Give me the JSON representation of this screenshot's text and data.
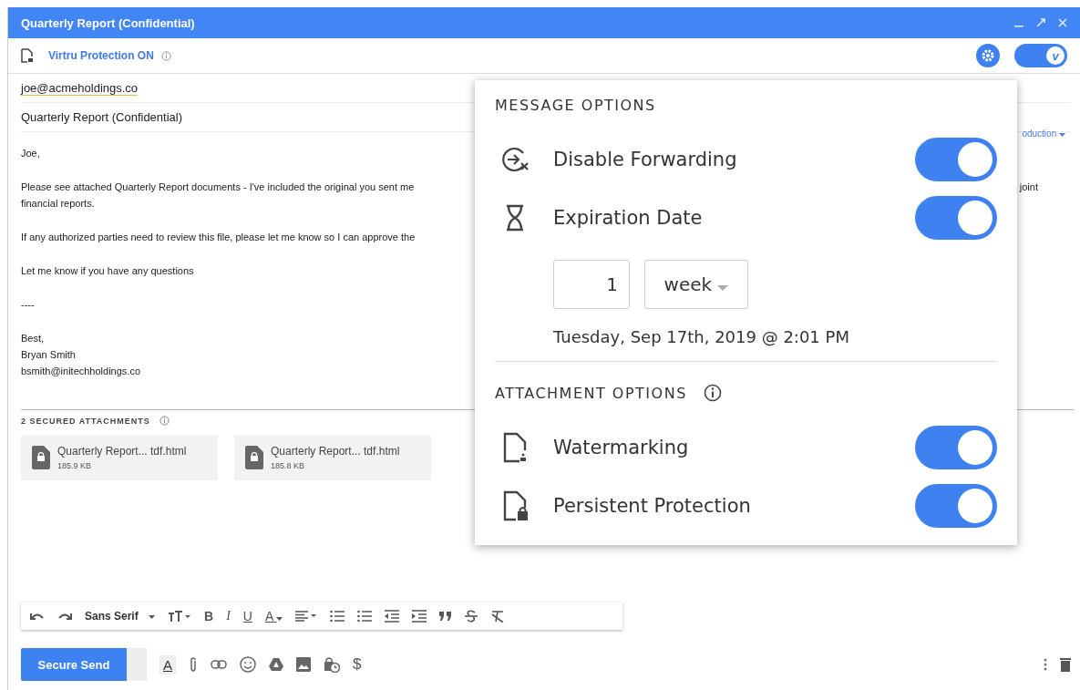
{
  "window": {
    "title": "Quarterly Report (Confidential)"
  },
  "protection": {
    "label": "Virtru Protection ON",
    "on": true,
    "toggle_mark": "v"
  },
  "to": "joe@acmeholdings.co",
  "subject": "Quarterly Report (Confidential)",
  "from_fragment": "oduction",
  "body_paragraphs": [
    {
      "lines": [
        "Joe,"
      ]
    },
    {
      "lines": [
        "Please see attached Quarterly Report documents - I've included the original you sent me",
        "financial reports."
      ],
      "tail": "joint"
    },
    {
      "lines": [
        "If any authorized parties need to review this file, please let me know so I can approve the"
      ]
    },
    {
      "lines": [
        "Let me know if you have any questions"
      ]
    },
    {
      "lines": [
        "----"
      ]
    },
    {
      "lines": [
        "Best,",
        "Bryan Smith",
        "bsmith@initechholdings.co"
      ]
    }
  ],
  "attachments": {
    "title": "2 SECURED ATTACHMENTS",
    "files": [
      {
        "name": "Quarterly Report... tdf.html",
        "size": "185.9 KB"
      },
      {
        "name": "Quarterly Report... tdf.html",
        "size": "185.8 KB"
      }
    ]
  },
  "format_toolbar": [
    {
      "kind": "undo"
    },
    {
      "kind": "redo"
    },
    {
      "kind": "font",
      "text": "Sans Serif"
    },
    {
      "kind": "size"
    },
    {
      "kind": "bold",
      "text": "B"
    },
    {
      "kind": "italic",
      "text": "I"
    },
    {
      "kind": "underline",
      "text": "U"
    },
    {
      "kind": "color",
      "text": "A"
    },
    {
      "kind": "align"
    },
    {
      "kind": "numbered"
    },
    {
      "kind": "bulleted"
    },
    {
      "kind": "outdent"
    },
    {
      "kind": "indent"
    },
    {
      "kind": "quote"
    },
    {
      "kind": "strike"
    },
    {
      "kind": "clear"
    }
  ],
  "send_bar": {
    "send": "Secure Send",
    "format_text": "A",
    "money": "$"
  },
  "popover": {
    "message_title": "MESSAGE OPTIONS",
    "message_options": [
      {
        "kind": "forward",
        "label": "Disable Forwarding",
        "on": true
      },
      {
        "kind": "expire",
        "label": "Expiration Date",
        "on": true
      }
    ],
    "expiration": {
      "amount": "1",
      "unit": "week",
      "date": "Tuesday, Sep 17th, 2019 @ 2:01 PM"
    },
    "attachment_title": "ATTACHMENT OPTIONS",
    "attachment_options": [
      {
        "kind": "watermark",
        "label": "Watermarking",
        "on": true
      },
      {
        "kind": "persist",
        "label": "Persistent Protection",
        "on": true
      }
    ]
  }
}
